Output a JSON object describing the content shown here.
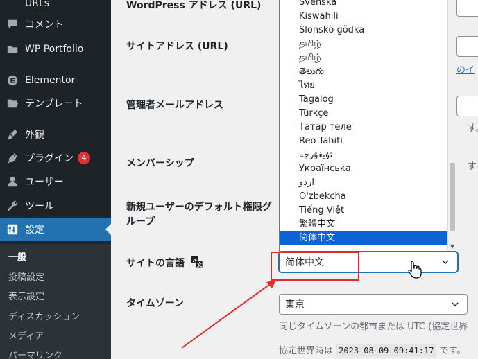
{
  "sidebar": {
    "items": [
      {
        "label": "URLs",
        "icon": "link-icon"
      },
      {
        "label": "コメント",
        "icon": "comment-icon"
      },
      {
        "label": "WP Portfolio",
        "icon": "folder-icon"
      },
      {
        "label": "Elementor",
        "icon": "elementor-icon"
      },
      {
        "label": "テンプレート",
        "icon": "folder-open-icon"
      },
      {
        "label": "外観",
        "icon": "brush-icon"
      },
      {
        "label": "プラグイン",
        "icon": "plugin-icon",
        "badge": "4"
      },
      {
        "label": "ユーザー",
        "icon": "user-icon"
      },
      {
        "label": "ツール",
        "icon": "wrench-icon"
      },
      {
        "label": "設定",
        "icon": "settings-icon",
        "active": true
      }
    ],
    "submenu": [
      {
        "label": "一般",
        "current": true
      },
      {
        "label": "投稿設定"
      },
      {
        "label": "表示設定"
      },
      {
        "label": "ディスカッション"
      },
      {
        "label": "メディア"
      },
      {
        "label": "パーマリンク"
      }
    ]
  },
  "form": {
    "wp_address_label": "WordPress アドレス (URL)",
    "site_address_label": "サイトアドレス (URL)",
    "site_address_link_fragment": "のイ",
    "admin_email_label": "管理者メールアドレス",
    "admin_email_hint_fragment": "す。変",
    "membership_label": "メンバーシップ",
    "membership_hint_fragment": "する",
    "default_role_label": "新規ユーザーのデフォルト権限グループ",
    "site_language_label": "サイトの言語",
    "site_language_value": "简体中文",
    "timezone_label": "タイムゾーン",
    "timezone_value": "東京",
    "timezone_hint": "同じタイムゾーンの都市または UTC (協定世界",
    "utc_prefix": "協定世界時は",
    "utc_time": "2023-08-09 09:41:17",
    "utc_suffix": "です。"
  },
  "language_options": [
    "Svenska",
    "Kiswahili",
    "Ślōnskŏ gŏdka",
    "தமிழ்",
    "தமிழ்",
    "తెలుగు",
    "ไทย",
    "Tagalog",
    "Türkçe",
    "Татар теле",
    "Reo Tahiti",
    "ئۇيغۇرچە",
    "Українська",
    "اردو",
    "O'zbekcha",
    "Tiếng Việt",
    "繁體中文",
    "简体中文"
  ],
  "selected_language_index": 17,
  "colors": {
    "sidebar_bg": "#1d2327",
    "accent": "#2271b1",
    "badge": "#d63638",
    "selection": "#0a64d6",
    "annotation_red": "#e02b2b"
  }
}
